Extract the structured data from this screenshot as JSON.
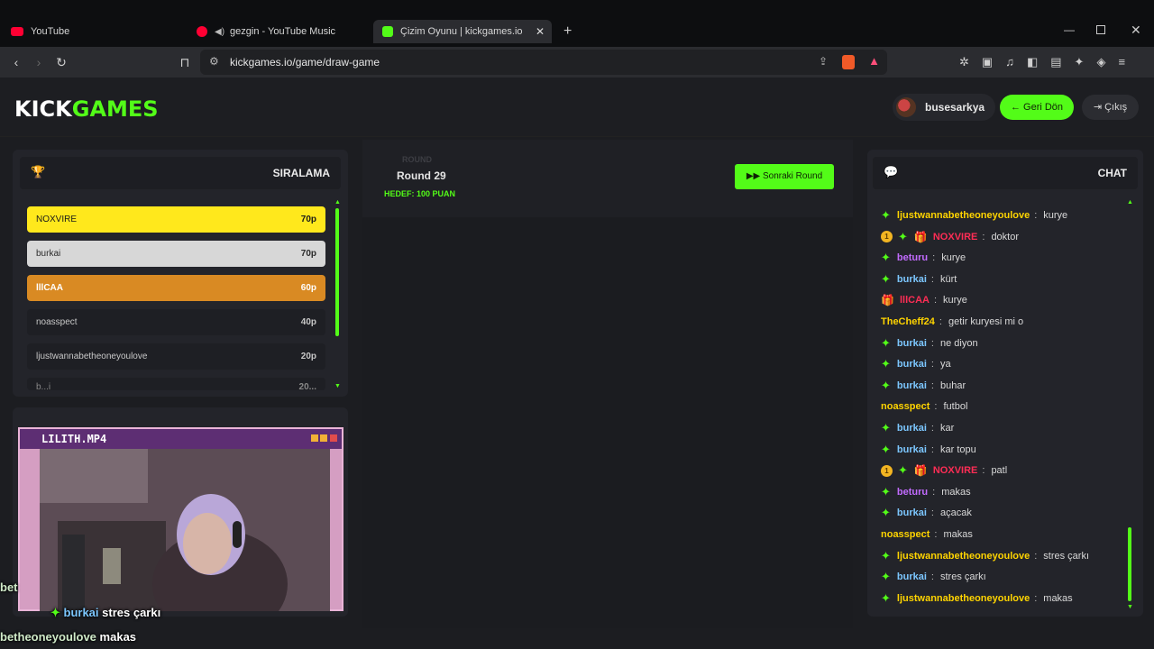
{
  "browser": {
    "tabs": [
      {
        "label": "YouTube",
        "color": "#ff0033"
      },
      {
        "label": "gezgin - YouTube Music",
        "color": "#ff0033"
      },
      {
        "label": "Çizim Oyunu | kickgames.io",
        "color": "#53fc18"
      }
    ],
    "url": "kickgames.io/game/draw-game"
  },
  "site": {
    "logo_a": "KICK",
    "logo_b": "GAMES",
    "username": "busesarkya",
    "back_label": "Geri Dön",
    "logout_label": "Çıkış"
  },
  "leaderboard": {
    "title": "SIRALAMA",
    "rows": [
      {
        "name": "NOXVIRE",
        "points": "70p"
      },
      {
        "name": "burkai",
        "points": "70p"
      },
      {
        "name": "lllCAA",
        "points": "60p"
      },
      {
        "name": "noasspect",
        "points": "40p"
      },
      {
        "name": "ljustwannabetheoneyoulove",
        "points": "20p"
      },
      {
        "name": "b...i",
        "points": "20..."
      }
    ]
  },
  "game": {
    "round_small": "ROUND",
    "round_label": "Round 29",
    "target_label": "HEDEF: 100 PUAN",
    "next_round_label": "Sonraki Round"
  },
  "video": {
    "title": "LILITH.MP4"
  },
  "overlay": {
    "line1_prefix": "bet",
    "line2_name": "burkai",
    "line2_msg": "stres çarkı",
    "line3_name": "betheoneyoulove",
    "line3_msg": "makas"
  },
  "chat": {
    "title": "CHAT",
    "messages": [
      {
        "badges": [
          "star"
        ],
        "user": "ljustwannabetheoneyoulove",
        "color": "#ffd400",
        "text": "kurye"
      },
      {
        "badges": [
          "coin",
          "star",
          "gift"
        ],
        "user": "NOXVIRE",
        "color": "#ff2d55",
        "text": "doktor"
      },
      {
        "badges": [
          "star"
        ],
        "user": "beturu",
        "color": "#c26bff",
        "text": "kurye"
      },
      {
        "badges": [
          "star"
        ],
        "user": "burkai",
        "color": "#7cc7ff",
        "text": "kürt"
      },
      {
        "badges": [
          "gift"
        ],
        "user": "lllCAA",
        "color": "#ff2d55",
        "text": "kurye"
      },
      {
        "badges": [],
        "user": "TheCheff24",
        "color": "#ffd400",
        "text": "getir kuryesi mi o"
      },
      {
        "badges": [
          "star"
        ],
        "user": "burkai",
        "color": "#7cc7ff",
        "text": "ne diyon"
      },
      {
        "badges": [
          "star"
        ],
        "user": "burkai",
        "color": "#7cc7ff",
        "text": "ya"
      },
      {
        "badges": [
          "star"
        ],
        "user": "burkai",
        "color": "#7cc7ff",
        "text": "buhar"
      },
      {
        "badges": [],
        "user": "noasspect",
        "color": "#ffd400",
        "text": "futbol"
      },
      {
        "badges": [
          "star"
        ],
        "user": "burkai",
        "color": "#7cc7ff",
        "text": "kar"
      },
      {
        "badges": [
          "star"
        ],
        "user": "burkai",
        "color": "#7cc7ff",
        "text": "kar topu"
      },
      {
        "badges": [
          "coin",
          "star",
          "gift"
        ],
        "user": "NOXVIRE",
        "color": "#ff2d55",
        "text": "patl"
      },
      {
        "badges": [
          "star"
        ],
        "user": "beturu",
        "color": "#c26bff",
        "text": "makas"
      },
      {
        "badges": [
          "star"
        ],
        "user": "burkai",
        "color": "#7cc7ff",
        "text": "açacak"
      },
      {
        "badges": [],
        "user": "noasspect",
        "color": "#ffd400",
        "text": "makas"
      },
      {
        "badges": [
          "star"
        ],
        "user": "ljustwannabetheoneyoulove",
        "color": "#ffd400",
        "text": "stres çarkı"
      },
      {
        "badges": [
          "star"
        ],
        "user": "burkai",
        "color": "#7cc7ff",
        "text": "stres çarkı"
      },
      {
        "badges": [
          "star"
        ],
        "user": "ljustwannabetheoneyoulove",
        "color": "#ffd400",
        "text": "makas"
      }
    ]
  },
  "colors": {
    "accent": "#53fc18",
    "gold": "#ffe81c",
    "silver": "#d7d7d7",
    "bronze": "#d98a23"
  }
}
